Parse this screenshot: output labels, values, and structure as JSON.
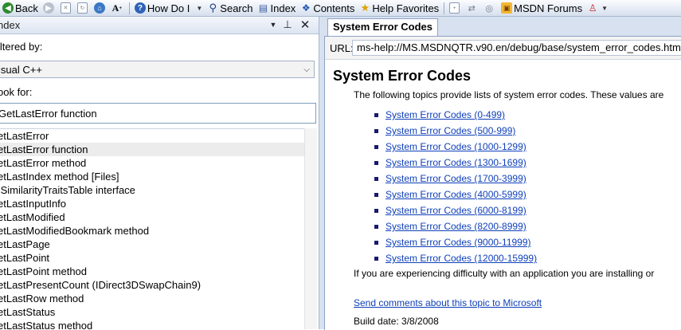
{
  "toolbar": {
    "back_label": "Back",
    "howdoi_label": "How Do I",
    "search_label": "Search",
    "index_label": "Index",
    "contents_label": "Contents",
    "helpfav_label": "Help Favorites",
    "msdn_label": "MSDN Forums"
  },
  "index_pane": {
    "title": "ndex",
    "filtered_label": "iltered by:",
    "filter_value": "isual C++",
    "look_label": "ook for:",
    "look_value": "GetLastError function",
    "items": [
      "etLastError",
      "etLastError function",
      "etLastError method",
      "etLastIndex method [Files]",
      "ISimilarityTraitsTable interface",
      "etLastInputInfo",
      "etLastModified",
      "etLastModifiedBookmark method",
      "etLastPage",
      "etLastPoint",
      "etLastPoint method",
      "etLastPresentCount (IDirect3DSwapChain9)",
      "etLastRow method",
      "etLastStatus",
      "etLastStatus method"
    ],
    "selected_index": 1
  },
  "doc": {
    "tab_label": "System Error Codes",
    "url_label": "URL:",
    "url_value": "ms-help://MS.MSDNQTR.v90.en/debug/base/system_error_codes.htm",
    "title": "System Error Codes",
    "intro": "The following topics provide lists of system error codes. These values are",
    "links": [
      "System Error Codes (0-499)",
      "System Error Codes (500-999)",
      "System Error Codes (1000-1299)",
      "System Error Codes (1300-1699)",
      "System Error Codes (1700-3999)",
      "System Error Codes (4000-5999)",
      "System Error Codes (6000-8199)",
      "System Error Codes (8200-8999)",
      "System Error Codes (9000-11999)",
      "System Error Codes (12000-15999)"
    ],
    "trouble_text": "If you are experiencing difficulty with an application you are installing or",
    "feedback_link": "Send comments about this topic to Microsoft",
    "build_date": "Build date: 3/8/2008"
  },
  "colors": {
    "link": "#0e3fb8",
    "toolbar_bg": "#e4ebf5",
    "pane_bg": "#d7e1ef"
  }
}
